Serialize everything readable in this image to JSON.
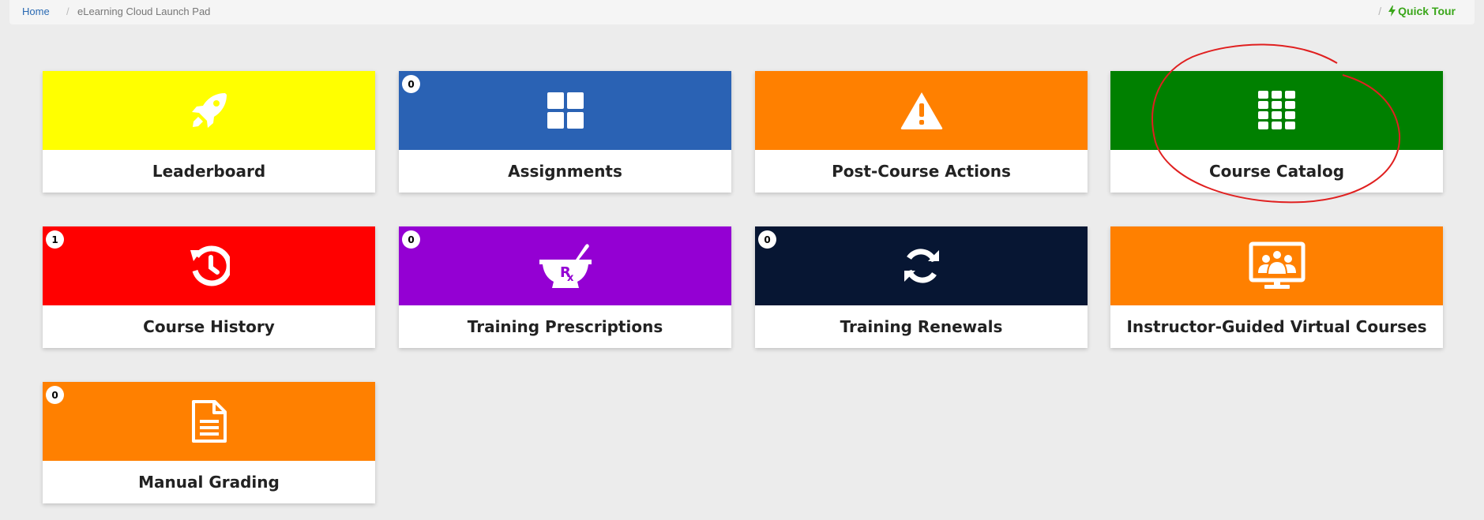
{
  "breadcrumb": {
    "home": "Home",
    "separator": "/",
    "current": "eLearning Cloud Launch Pad",
    "quick_tour": "Quick Tour"
  },
  "tiles": [
    {
      "label": "Leaderboard",
      "color": "#ffff00",
      "icon": "rocket-icon",
      "badge": null
    },
    {
      "label": "Assignments",
      "color": "#2a62b4",
      "icon": "grid-2x2-icon",
      "badge": "0"
    },
    {
      "label": "Post-Course Actions",
      "color": "#ff8000",
      "icon": "warning-icon",
      "badge": null
    },
    {
      "label": "Course Catalog",
      "color": "#008000",
      "icon": "grid-3x4-icon",
      "badge": null
    },
    {
      "label": "Course History",
      "color": "#ff0000",
      "icon": "history-icon",
      "badge": "1"
    },
    {
      "label": "Training Prescriptions",
      "color": "#9400d3",
      "icon": "mortar-pestle-rx-icon",
      "badge": "0"
    },
    {
      "label": "Training Renewals",
      "color": "#071633",
      "icon": "refresh-icon",
      "badge": "0"
    },
    {
      "label": "Instructor-Guided Virtual Courses",
      "color": "#ff8000",
      "icon": "virtual-classroom-icon",
      "badge": null
    },
    {
      "label": "Manual Grading",
      "color": "#ff8000",
      "icon": "document-icon",
      "badge": "0"
    }
  ],
  "annotation_color": "#e02020"
}
